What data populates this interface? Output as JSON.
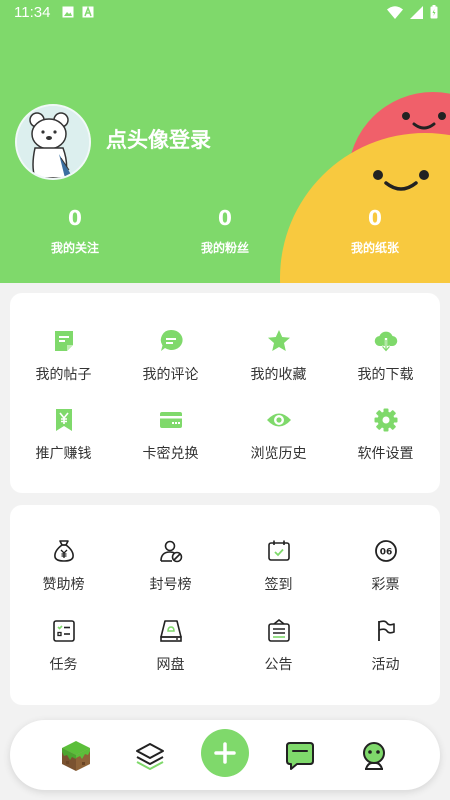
{
  "status_bar": {
    "time": "11:34"
  },
  "profile": {
    "login_prompt": "点头像登录"
  },
  "stats": [
    {
      "value": "0",
      "label": "我的关注"
    },
    {
      "value": "0",
      "label": "我的粉丝"
    },
    {
      "value": "0",
      "label": "我的纸张"
    }
  ],
  "features": [
    {
      "label": "我的帖子",
      "icon": "post-icon"
    },
    {
      "label": "我的评论",
      "icon": "comment-icon"
    },
    {
      "label": "我的收藏",
      "icon": "star-icon"
    },
    {
      "label": "我的下载",
      "icon": "cloud-download-icon"
    },
    {
      "label": "推广赚钱",
      "icon": "yen-tag-icon"
    },
    {
      "label": "卡密兑换",
      "icon": "card-icon"
    },
    {
      "label": "浏览历史",
      "icon": "eye-icon"
    },
    {
      "label": "软件设置",
      "icon": "gear-icon"
    }
  ],
  "tools": [
    {
      "label": "赞助榜",
      "icon": "money-bag-icon"
    },
    {
      "label": "封号榜",
      "icon": "user-ban-icon"
    },
    {
      "label": "签到",
      "icon": "calendar-check-icon"
    },
    {
      "label": "彩票",
      "icon": "lottery-ball-icon",
      "badge": "06"
    },
    {
      "label": "任务",
      "icon": "task-list-icon"
    },
    {
      "label": "网盘",
      "icon": "cloud-drive-icon"
    },
    {
      "label": "公告",
      "icon": "notice-icon"
    },
    {
      "label": "活动",
      "icon": "flag-icon"
    }
  ],
  "colors": {
    "brand_green": "#7fd96b",
    "pink": "#f0606a",
    "yellow": "#f8c93f"
  }
}
